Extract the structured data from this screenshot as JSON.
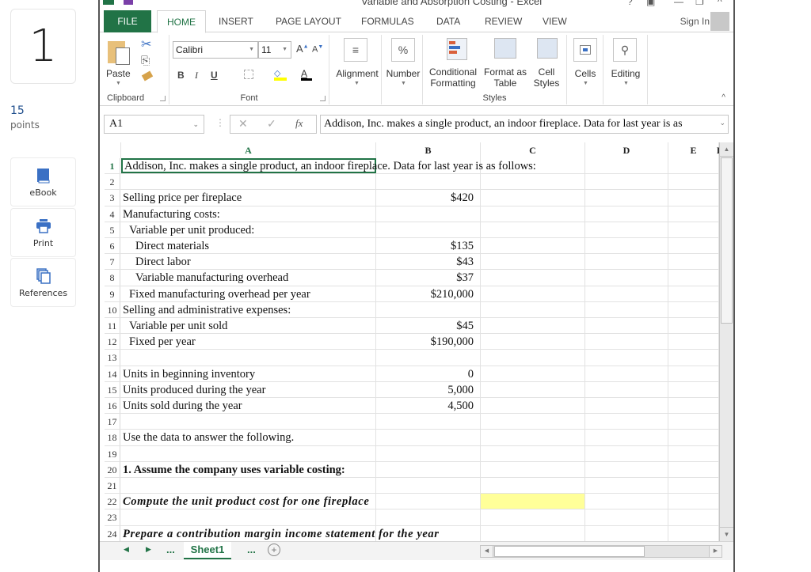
{
  "question_panel": {
    "number": "1",
    "points_value": "15",
    "points_label": "points",
    "tools": [
      {
        "label": "eBook",
        "icon": "book-icon"
      },
      {
        "label": "Print",
        "icon": "printer-icon"
      },
      {
        "label": "References",
        "icon": "copy-pages-icon"
      }
    ]
  },
  "window": {
    "title": "Variable and Absorption Costing - Excel",
    "sign_in": "Sign In"
  },
  "ribbon_tabs": [
    "FILE",
    "HOME",
    "INSERT",
    "PAGE LAYOUT",
    "FORMULAS",
    "DATA",
    "REVIEW",
    "VIEW"
  ],
  "active_tab": "HOME",
  "ribbon": {
    "clipboard": {
      "paste": "Paste",
      "group": "Clipboard"
    },
    "font": {
      "name": "Calibri",
      "size": "11",
      "group": "Font",
      "bold": "B",
      "italic": "I",
      "underline": "U",
      "font_color_letter": "A"
    },
    "alignment": {
      "label": "Alignment"
    },
    "number": {
      "label": "Number",
      "symbol": "%"
    },
    "styles": {
      "conditional_1": "Conditional",
      "conditional_2": "Formatting",
      "format_table_1": "Format as",
      "format_table_2": "Table",
      "cell_styles_1": "Cell",
      "cell_styles_2": "Styles",
      "group": "Styles"
    },
    "cells": {
      "label": "Cells"
    },
    "editing": {
      "label": "Editing"
    },
    "colors": {
      "fill_highlight": "#ffff00",
      "font_color": "#000000"
    }
  },
  "formula_bar": {
    "name_box": "A1",
    "fx": "fx",
    "content": "Addison, Inc. makes a single product, an indoor fireplace. Data for last year is as"
  },
  "columns": [
    "A",
    "B",
    "C",
    "D",
    "E",
    "I"
  ],
  "rows": [
    {
      "n": "1",
      "a": "Addison, Inc. makes a single product, an indoor fireplace. Data for last year is as follows:",
      "b": "",
      "style": "normal"
    },
    {
      "n": "2",
      "a": "",
      "b": ""
    },
    {
      "n": "3",
      "a": "Selling price per fireplace",
      "b": "$420",
      "indent": 0
    },
    {
      "n": "4",
      "a": "Manufacturing costs:",
      "b": "",
      "indent": 0
    },
    {
      "n": "5",
      "a": "Variable per unit produced:",
      "b": "",
      "indent": 1
    },
    {
      "n": "6",
      "a": "Direct materials",
      "b": "$135",
      "indent": 2
    },
    {
      "n": "7",
      "a": "Direct labor",
      "b": "$43",
      "indent": 2
    },
    {
      "n": "8",
      "a": "Variable manufacturing overhead",
      "b": "$37",
      "indent": 2
    },
    {
      "n": "9",
      "a": "Fixed manufacturing overhead per year",
      "b": "$210,000",
      "indent": 1
    },
    {
      "n": "10",
      "a": "Selling and administrative expenses:",
      "b": "",
      "indent": 0
    },
    {
      "n": "11",
      "a": "Variable per unit sold",
      "b": "$45",
      "indent": 1
    },
    {
      "n": "12",
      "a": "Fixed per year",
      "b": "$190,000",
      "indent": 1
    },
    {
      "n": "13",
      "a": "",
      "b": ""
    },
    {
      "n": "14",
      "a": "Units in beginning inventory",
      "b": "0",
      "indent": 0
    },
    {
      "n": "15",
      "a": "Units produced during the year",
      "b": "5,000",
      "indent": 0
    },
    {
      "n": "16",
      "a": "Units sold during the year",
      "b": "4,500",
      "indent": 0
    },
    {
      "n": "17",
      "a": "",
      "b": ""
    },
    {
      "n": "18",
      "a": "Use the data to answer the following.",
      "b": "",
      "indent": 0
    },
    {
      "n": "19",
      "a": "",
      "b": ""
    },
    {
      "n": "20",
      "a": "1. Assume the company uses variable costing:",
      "b": "",
      "style": "bold"
    },
    {
      "n": "21",
      "a": "",
      "b": ""
    },
    {
      "n": "22",
      "a": "Compute the unit product cost for one fireplace",
      "b": "",
      "style": "italic-bold",
      "c_highlight": "#ffff99"
    },
    {
      "n": "23",
      "a": "",
      "b": ""
    },
    {
      "n": "24",
      "a": "Prepare a contribution margin income statement for the year",
      "b": "",
      "style": "italic-bold"
    }
  ],
  "sheet_tabs": {
    "active": "Sheet1",
    "ellipsis": "..."
  },
  "accent": "#217346"
}
